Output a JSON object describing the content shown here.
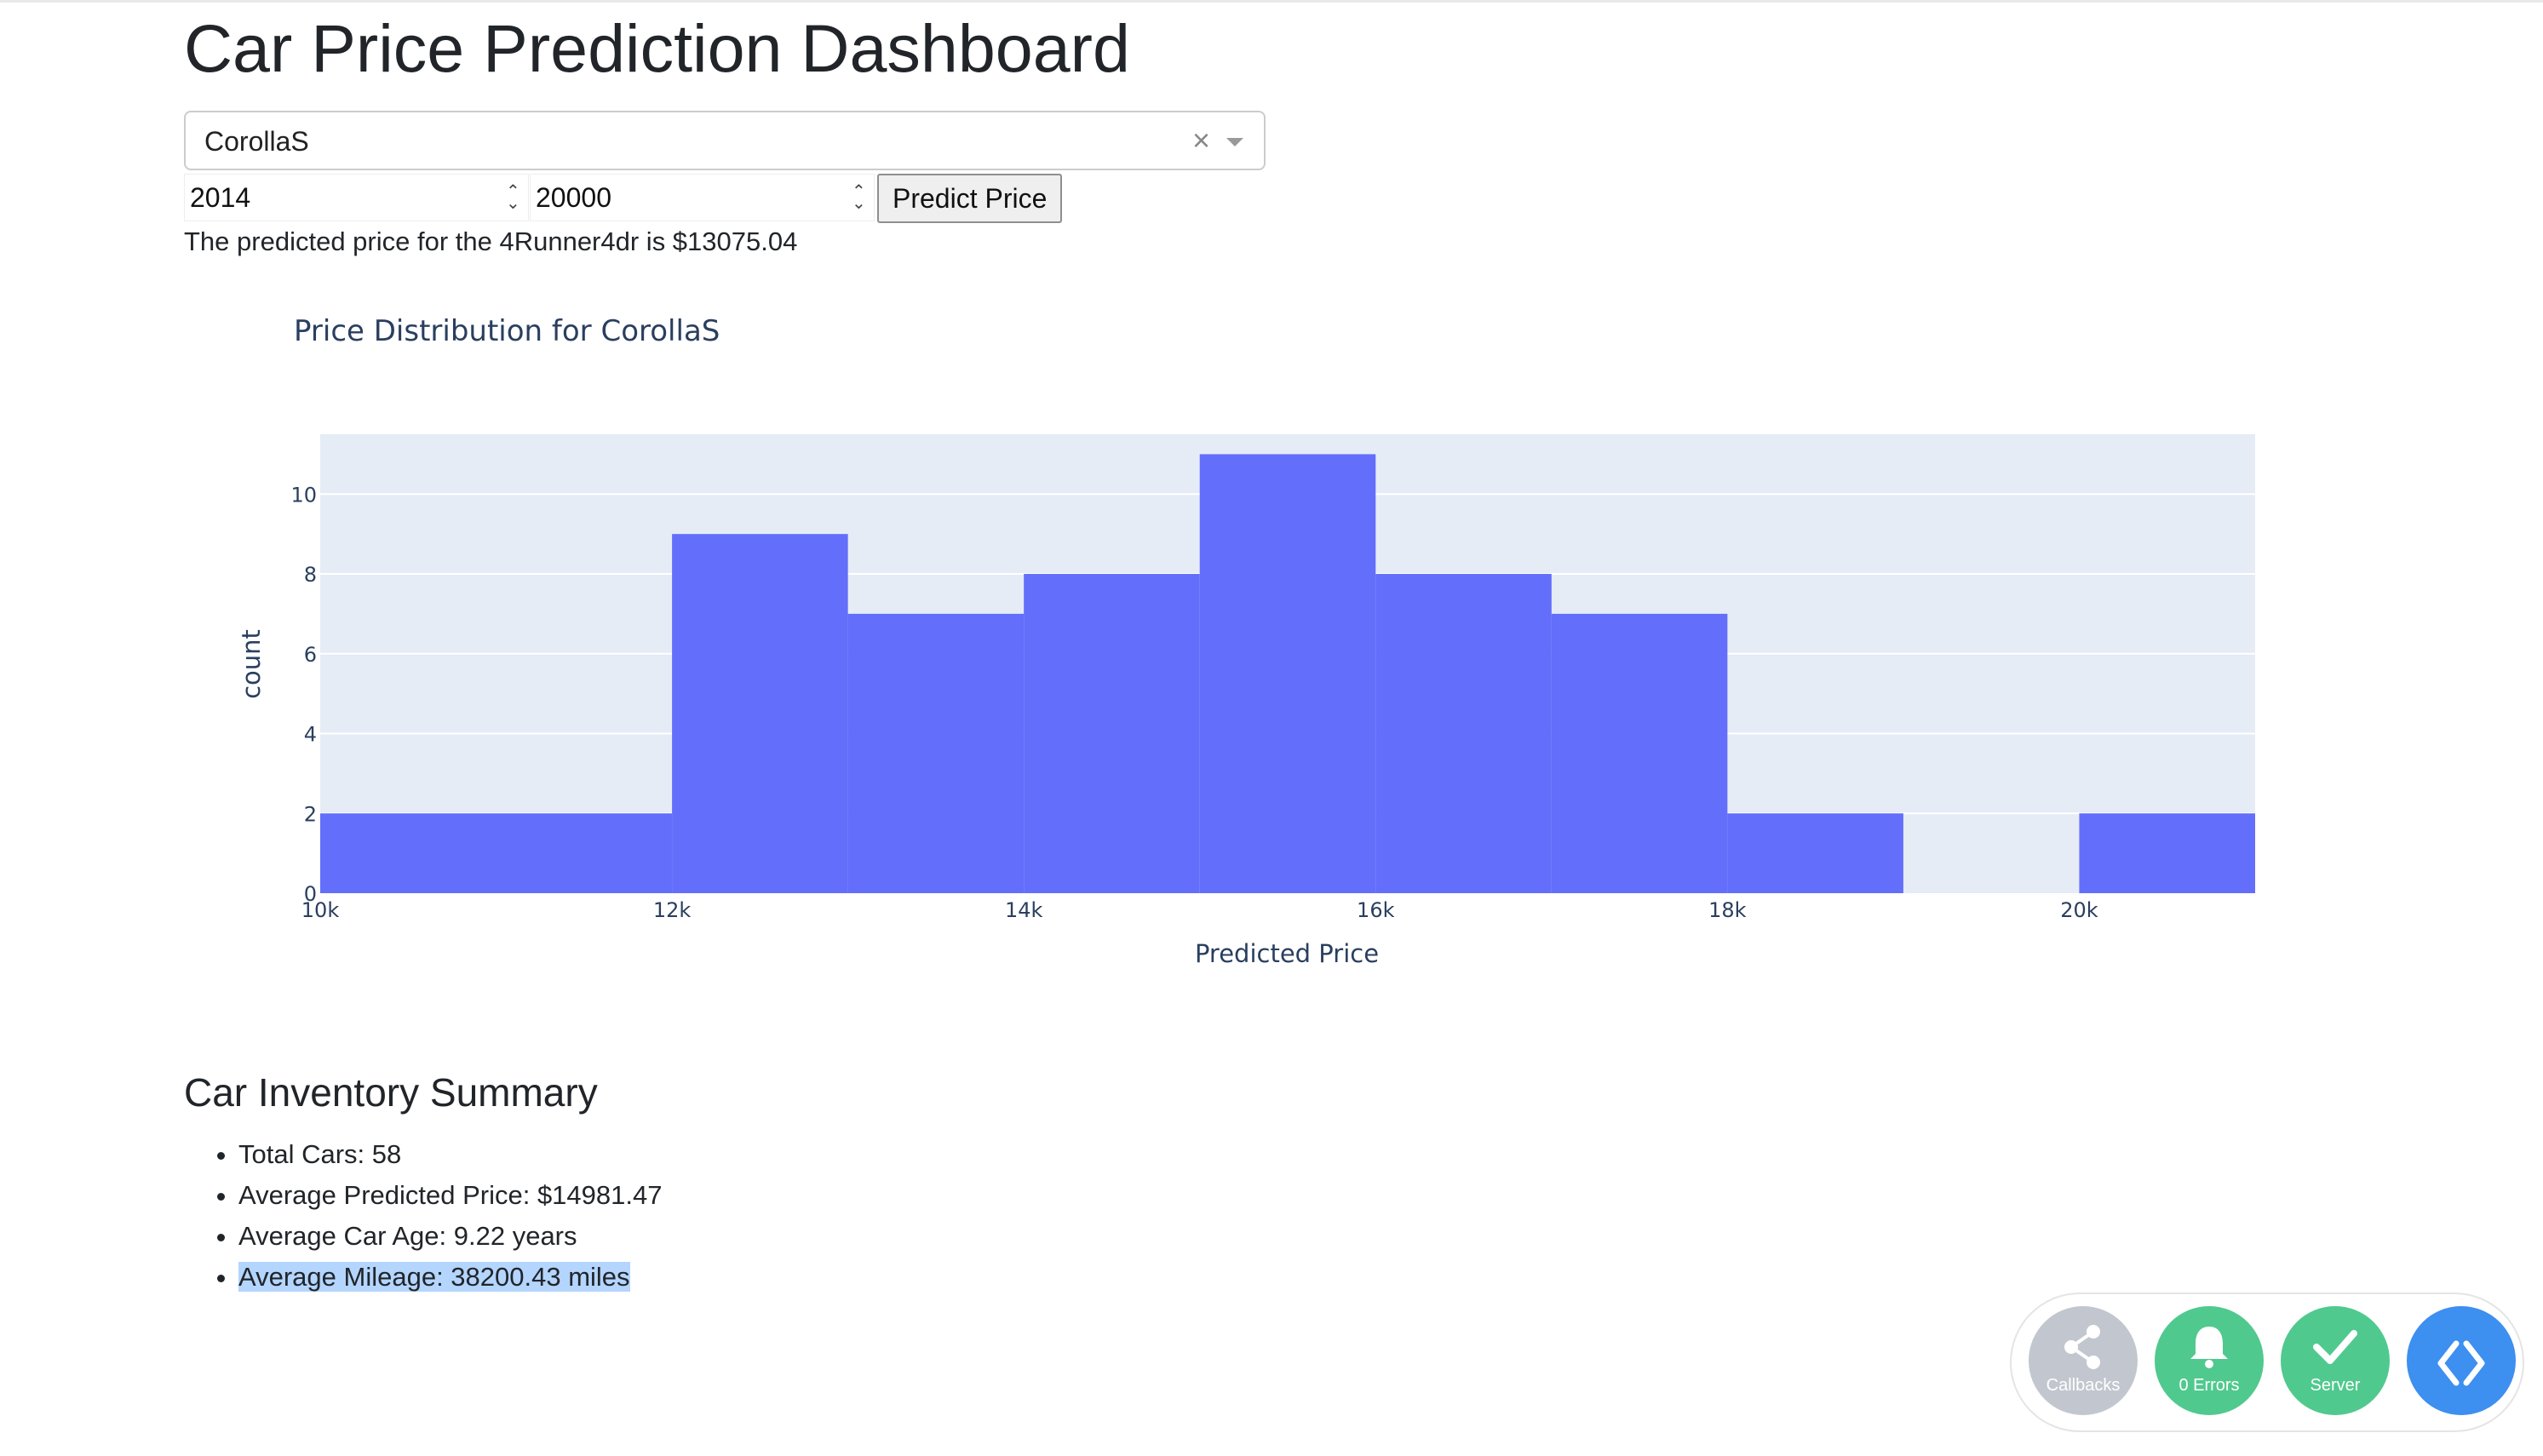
{
  "page": {
    "title": "Car Price Prediction Dashboard",
    "model_dropdown": {
      "value": "CorollaS",
      "clear_symbol": "×"
    },
    "year_input": "2014",
    "mileage_input": "20000",
    "predict_button": "Predict Price",
    "prediction_text": "The predicted price for the 4Runner4dr is $13075.04"
  },
  "chart_data": {
    "type": "bar",
    "title": "Price Distribution for CorollaS",
    "xlabel": "Predicted Price",
    "ylabel": "count",
    "bins": [
      {
        "x0": 10000,
        "x1": 12000,
        "count": 2
      },
      {
        "x0": 12000,
        "x1": 13000,
        "count": 9
      },
      {
        "x0": 13000,
        "x1": 14000,
        "count": 7
      },
      {
        "x0": 14000,
        "x1": 15000,
        "count": 8
      },
      {
        "x0": 15000,
        "x1": 16000,
        "count": 11
      },
      {
        "x0": 16000,
        "x1": 17000,
        "count": 8
      },
      {
        "x0": 17000,
        "x1": 18000,
        "count": 7
      },
      {
        "x0": 18000,
        "x1": 19000,
        "count": 2
      },
      {
        "x0": 19000,
        "x1": 20000,
        "count": 0
      },
      {
        "x0": 20000,
        "x1": 21000,
        "count": 2
      }
    ],
    "xlim": [
      10000,
      21000
    ],
    "ylim": [
      0,
      11.5
    ],
    "xticks": [
      10000,
      12000,
      14000,
      16000,
      18000,
      20000
    ],
    "xtick_labels": [
      "10k",
      "12k",
      "14k",
      "16k",
      "18k",
      "20k"
    ],
    "yticks": [
      0,
      2,
      4,
      6,
      8,
      10
    ],
    "ytick_labels": [
      "0",
      "2",
      "4",
      "6",
      "8",
      "10"
    ],
    "grid": true,
    "bar_color": "#636efa",
    "plot_bg": "#e5ecf6"
  },
  "summary": {
    "title": "Car Inventory Summary",
    "items": [
      "Total Cars: 58",
      "Average Predicted Price: $14981.47",
      "Average Car Age: 9.22 years",
      "Average Mileage: 38200.43 miles"
    ]
  },
  "debug_menu": {
    "callbacks": "Callbacks",
    "errors": "0 Errors",
    "server": "Server",
    "callbacks_icon": "share-icon",
    "errors_icon": "bell-icon",
    "server_icon": "check-icon",
    "devtools_icon": "code-icon",
    "colors": {
      "callbacks": "#c2c7cf",
      "errors": "#50c98e",
      "server": "#50c98e",
      "devtools": "#3d8ff0"
    }
  }
}
